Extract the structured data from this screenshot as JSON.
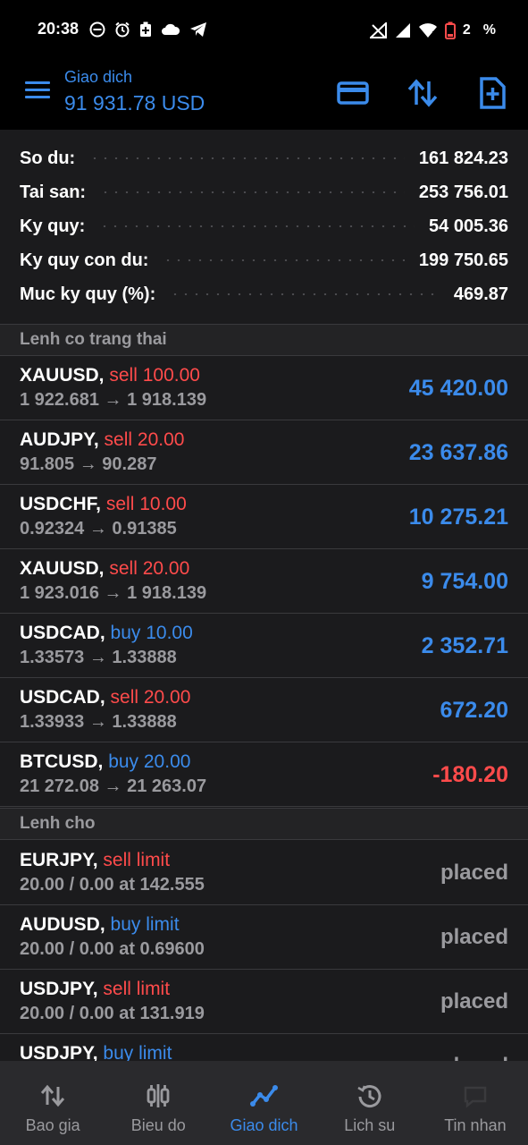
{
  "status_bar": {
    "time": "20:38",
    "battery_text": "2",
    "percent_symbol": "%"
  },
  "app_bar": {
    "title": "Giao dich",
    "balance": "91 931.78 USD"
  },
  "summary": [
    {
      "label": "So du:",
      "value": "161 824.23"
    },
    {
      "label": "Tai san:",
      "value": "253 756.01"
    },
    {
      "label": "Ky quy:",
      "value": "54 005.36"
    },
    {
      "label": "Ky quy con du:",
      "value": "199 750.65"
    },
    {
      "label": "Muc ky quy (%):",
      "value": "469.87"
    }
  ],
  "positions_header": "Lenh co trang thai",
  "positions": [
    {
      "symbol": "XAUUSD,",
      "side": "sell 100.00",
      "prices": "1 922.681 → 1 918.139",
      "profit": "45 420.00"
    },
    {
      "symbol": "AUDJPY,",
      "side": "sell 20.00",
      "prices": "91.805 → 90.287",
      "profit": "23 637.86"
    },
    {
      "symbol": "USDCHF,",
      "side": "sell 10.00",
      "prices": "0.92324 → 0.91385",
      "profit": "10 275.21"
    },
    {
      "symbol": "XAUUSD,",
      "side": "sell 20.00",
      "prices": "1 923.016 → 1 918.139",
      "profit": "9 754.00"
    },
    {
      "symbol": "USDCAD,",
      "side": "buy 10.00",
      "prices": "1.33573 → 1.33888",
      "profit": "2 352.71"
    },
    {
      "symbol": "USDCAD,",
      "side": "sell 20.00",
      "prices": "1.33933 → 1.33888",
      "profit": "672.20"
    },
    {
      "symbol": "BTCUSD,",
      "side": "buy 20.00",
      "prices": "21 272.08 → 21 263.07",
      "profit": "-180.20"
    }
  ],
  "orders_header": "Lenh cho",
  "orders": [
    {
      "symbol": "EURJPY,",
      "side": "sell limit",
      "details": "20.00 / 0.00 at 142.555",
      "status": "placed"
    },
    {
      "symbol": "AUDUSD,",
      "side": "buy limit",
      "details": "20.00 / 0.00 at 0.69600",
      "status": "placed"
    },
    {
      "symbol": "USDJPY,",
      "side": "sell limit",
      "details": "20.00 / 0.00 at 131.919",
      "status": "placed"
    },
    {
      "symbol": "USDJPY,",
      "side": "buy limit",
      "details": "",
      "status": "placed"
    }
  ],
  "bottom_nav": [
    {
      "label": "Bao gia",
      "icon": "arrows-updown-icon"
    },
    {
      "label": "Bieu do",
      "icon": "candlestick-icon"
    },
    {
      "label": "Giao dich",
      "icon": "trade-chart-icon",
      "active": true
    },
    {
      "label": "Lich su",
      "icon": "history-icon"
    },
    {
      "label": "Tin nhan",
      "icon": "chat-icon"
    }
  ],
  "colors": {
    "accent_blue": "#3b8beb",
    "sell_red": "#ff4b4b",
    "background": "#1b1b1d"
  }
}
